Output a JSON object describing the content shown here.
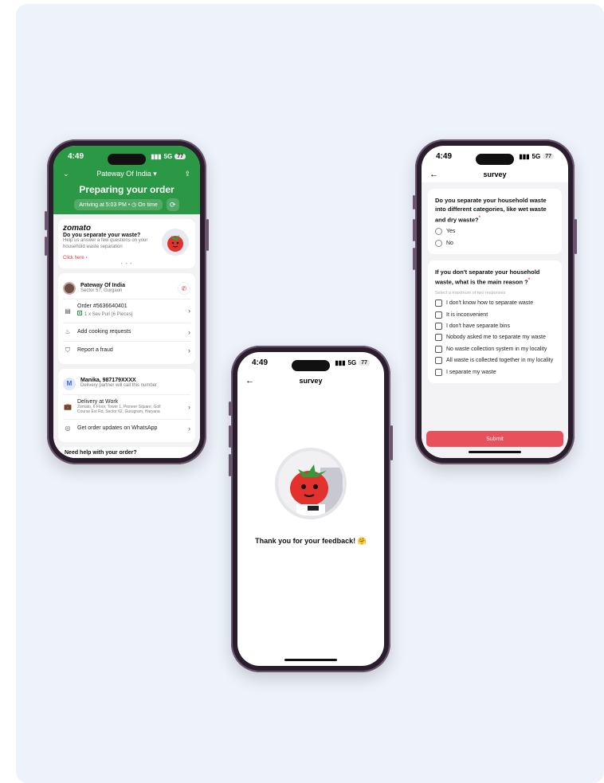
{
  "phone1": {
    "time": "4:49",
    "network": "5G",
    "battery": "77",
    "restaurant_dropdown": "Pateway Of India",
    "title": "Preparing your order",
    "arrival": "Arriving at 5:03 PM",
    "on_time": "On time",
    "banner": {
      "brand": "zomato",
      "title": "Do you separate your waste?",
      "subtitle": "Help us answer a few questions on your household waste separation",
      "link": "Click here ›"
    },
    "restaurant": {
      "name": "Pateway Of India",
      "location": "Sector 57, Gurgaon"
    },
    "order": {
      "number": "Order #5636640401",
      "item": "1 x Sev Puri [6 Pieces]"
    },
    "add_cooking": "Add cooking requests",
    "report": "Report a fraud",
    "partner": {
      "initial": "M",
      "name": "Manika, 987179XXXX",
      "note": "Delivery partner will call this number"
    },
    "delivery": {
      "title": "Delivery at Work",
      "address": "Zomato, 6 Floor, Tower 1, Pioneer Square, Golf Course Ext Rd, Sector 62, Gurugram, Haryana"
    },
    "whatsapp": "Get order updates on WhatsApp",
    "help": "Need help with your order?"
  },
  "phone2": {
    "time": "4:49",
    "network": "5G",
    "battery": "77",
    "title": "survey",
    "thanks": "Thank you for your feedback! 🤗"
  },
  "phone3": {
    "time": "4:49",
    "network": "5G",
    "battery": "77",
    "title": "survey",
    "q1": {
      "text": "Do you separate your household waste into different categories, like wet waste and dry waste?",
      "required": "*",
      "options": [
        "Yes",
        "No"
      ]
    },
    "q2": {
      "text": "If you don't separate your household waste, what is the main reason ?",
      "required": "*",
      "hint": "Select a maximum of two responses",
      "options": [
        "I don't know how to separate waste",
        "It is inconvenient",
        "I don't have separate bins",
        "Nobody asked me to separate my waste",
        "No waste collection system in my locality",
        "All waste is collected together in my locality",
        "I separate my waste"
      ]
    },
    "submit": "Submit"
  },
  "colors": {
    "green": "#2b9845",
    "accent": "#e8505b",
    "background": "#eef3fb"
  }
}
